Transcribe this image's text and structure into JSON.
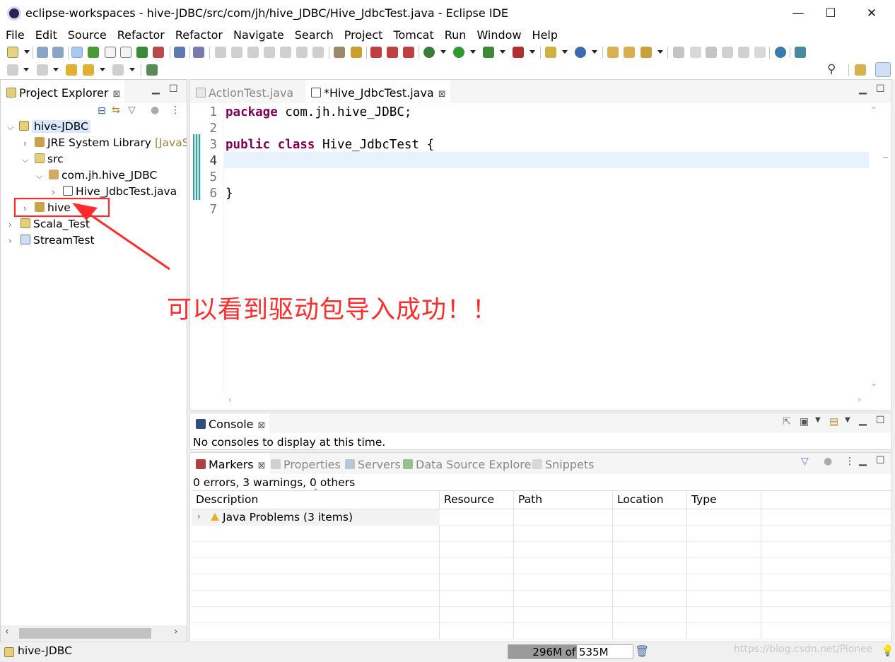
{
  "window": {
    "title": "eclipse-workspaces - hive-JDBC/src/com/jh/hive_JDBC/Hive_JdbcTest.java - Eclipse IDE",
    "minimize": "—",
    "maximize": "☐",
    "close": "✕"
  },
  "menu": [
    "File",
    "Edit",
    "Source",
    "Refactor",
    "Refactor",
    "Navigate",
    "Search",
    "Project",
    "Tomcat",
    "Run",
    "Window",
    "Help"
  ],
  "explorer": {
    "tab_label": "Project Explorer",
    "tree": [
      {
        "label": "hive-JDBC",
        "level": 0,
        "expanded": true,
        "selected": true
      },
      {
        "label": "JRE System Library",
        "suffix": "[JavaSE-",
        "level": 1,
        "expanded": false
      },
      {
        "label": "src",
        "level": 1,
        "expanded": true
      },
      {
        "label": "com.jh.hive_JDBC",
        "level": 2,
        "expanded": true
      },
      {
        "label": "Hive_JdbcTest.java",
        "level": 3,
        "expanded": false
      },
      {
        "label": "hive",
        "level": 1,
        "expanded": false
      },
      {
        "label": "Scala_Test",
        "level": 0,
        "expanded": false
      },
      {
        "label": "StreamTest",
        "level": 0,
        "expanded": false
      }
    ]
  },
  "editor": {
    "tabs": [
      {
        "label": "ActionTest.java",
        "active": false
      },
      {
        "label": "*Hive_JdbcTest.java",
        "active": true
      }
    ],
    "lines": [
      {
        "n": "1",
        "parts": [
          {
            "t": "package",
            "kw": true
          },
          {
            "t": " com.jh.hive_JDBC;"
          }
        ]
      },
      {
        "n": "2",
        "parts": []
      },
      {
        "n": "3",
        "parts": [
          {
            "t": "public",
            "kw": true
          },
          {
            "t": " "
          },
          {
            "t": "class",
            "kw": true
          },
          {
            "t": " Hive_JdbcTest {"
          }
        ]
      },
      {
        "n": "4",
        "parts": []
      },
      {
        "n": "5",
        "parts": []
      },
      {
        "n": "6",
        "parts": [
          {
            "t": "}"
          }
        ]
      },
      {
        "n": "7",
        "parts": []
      }
    ],
    "current_line": 4
  },
  "console": {
    "tab_label": "Console",
    "message": "No consoles to display at this time."
  },
  "markers": {
    "tabs": [
      {
        "label": "Markers",
        "active": true
      },
      {
        "label": "Properties",
        "active": false
      },
      {
        "label": "Servers",
        "active": false
      },
      {
        "label": "Data Source Explorer",
        "active": false
      },
      {
        "label": "Snippets",
        "active": false
      }
    ],
    "summary": "0 errors, 3 warnings, 0 others",
    "columns": [
      "Description",
      "Resource",
      "Path",
      "Location",
      "Type"
    ],
    "rows": [
      {
        "description": "Java Problems (3 items)"
      }
    ]
  },
  "status": {
    "selection": "hive-JDBC",
    "heap": "296M of 535M",
    "heap_used_fraction": 0.553,
    "watermark": "https://blog.csdn.net/Pionee"
  },
  "annotation": {
    "text": "可以看到驱动包导入成功！！",
    "color": "#ff2a2a"
  },
  "colors": {
    "keyword": "#7f0055",
    "selection": "#d9e8fb",
    "current_line": "#e8f2fe",
    "annotation": "#ff2a2a"
  }
}
